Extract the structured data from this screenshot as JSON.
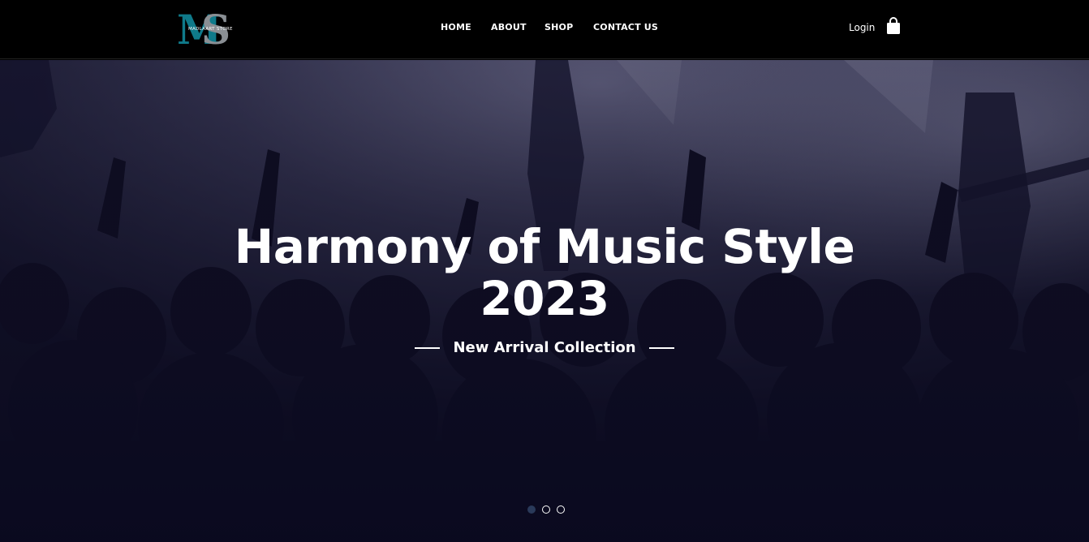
{
  "header": {
    "logo_letters": "MS",
    "logo_caption": "MADLAART STORE",
    "nav": [
      {
        "label": "HOME"
      },
      {
        "label": "ABOUT"
      },
      {
        "label": "SHOP"
      },
      {
        "label": "CONTACT US"
      }
    ],
    "login_label": "Login",
    "cart_icon": "shopping-bag-icon"
  },
  "hero": {
    "title_line1": "Harmony of Music Style",
    "title_line2": "2023",
    "subtitle": "New Arrival Collection",
    "slides_total": 3,
    "active_slide": 1
  },
  "colors": {
    "header_bg": "#000000",
    "logo_teal": "#0f7a8a",
    "logo_gray": "#8a8f94",
    "hero_overlay": "#0d0c1c",
    "text": "#ffffff"
  }
}
